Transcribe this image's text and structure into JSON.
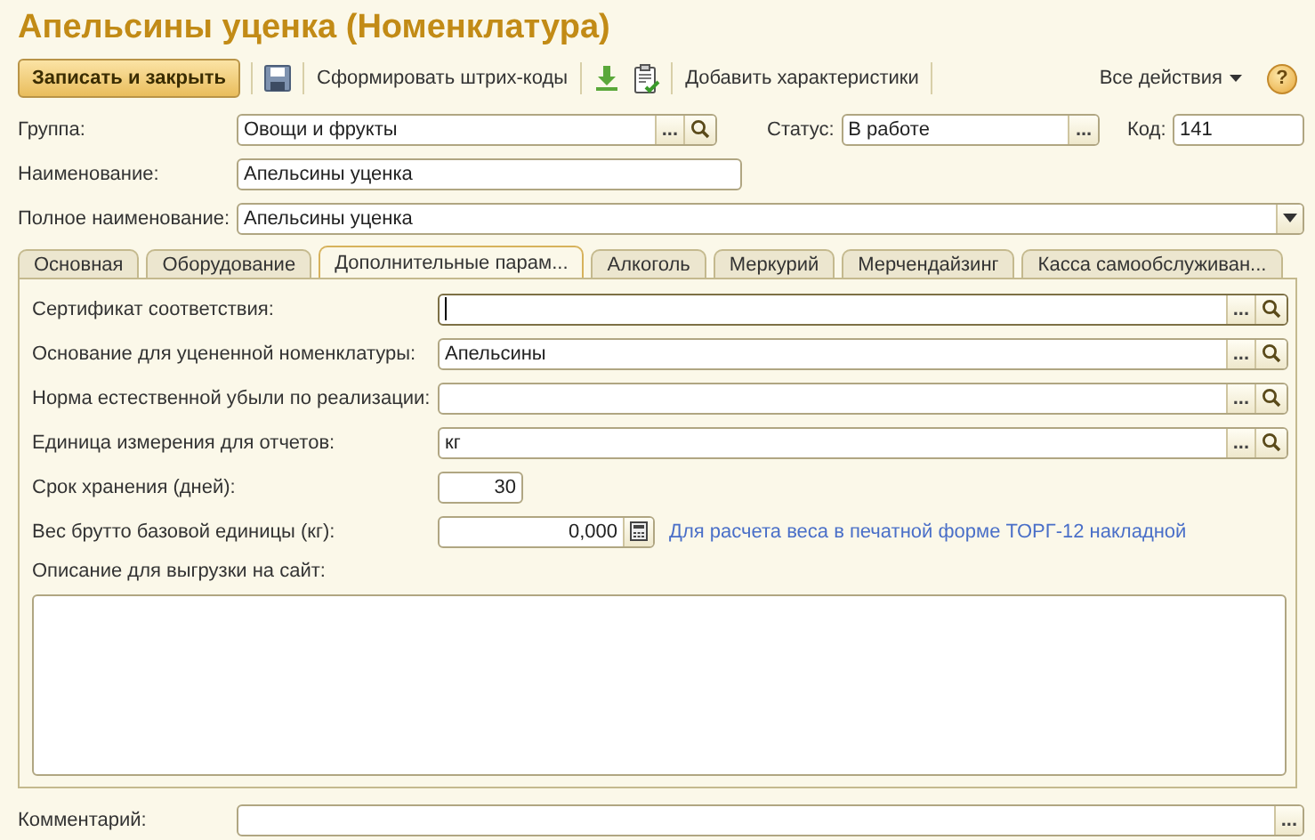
{
  "window": {
    "title": "Апельсины уценка (Номенклатура)"
  },
  "toolbar": [
    {
      "kind": "primary",
      "label": "Записать и закрыть"
    },
    {
      "kind": "save"
    },
    {
      "kind": "text",
      "label": "Сформировать штрих-коды"
    },
    {
      "kind": "download"
    },
    {
      "kind": "report"
    },
    {
      "kind": "text",
      "label": "Добавить характеристики"
    }
  ],
  "all_actions": {
    "label": "Все действия"
  },
  "help_button": {
    "label": "?"
  },
  "header_fields": [
    {
      "label": "Группа:",
      "value": "Овощи и фрукты",
      "kind": "lookup",
      "select_button": "..."
    },
    {
      "label": "Статус:",
      "value": "В работе",
      "kind": "select",
      "select_button": "..."
    },
    {
      "label": "Код:",
      "value": "141",
      "kind": "plain"
    },
    {
      "label": "Наименование:",
      "value": "Апельсины уценка",
      "kind": "plain"
    },
    {
      "label": "Полное наименование:",
      "value": "Апельсины уценка",
      "kind": "dropdown"
    }
  ],
  "tabs": [
    {
      "label": "Основная",
      "selected": false
    },
    {
      "label": "Оборудование",
      "selected": false
    },
    {
      "label": "Дополнительные парам...",
      "selected": true
    },
    {
      "label": "Алкоголь",
      "selected": false
    },
    {
      "label": "Меркурий",
      "selected": false
    },
    {
      "label": "Мерчендайзинг",
      "selected": false
    },
    {
      "label": "Касса самообслуживан...",
      "selected": false
    }
  ],
  "params": [
    {
      "label": "Сертификат соответствия:",
      "kind": "lookup",
      "select_button": "...",
      "focused": true
    },
    {
      "label": "Основание для уцененной номенклатуры:",
      "value": "Апельсины",
      "kind": "lookup",
      "select_button": "...",
      "focused": false
    },
    {
      "label": "Норма естественной убыли по реализации:",
      "kind": "lookup",
      "select_button": "...",
      "focused": false
    },
    {
      "label": "Единица измерения для отчетов:",
      "value": "кг",
      "kind": "lookup",
      "select_button": "...",
      "focused": false
    },
    {
      "label": "Срок хранения (дней):",
      "value": "30",
      "kind": "number",
      "focused": false
    },
    {
      "label": "Вес брутто базовой единицы (кг):",
      "value": "0,000",
      "kind": "calc",
      "focused": false,
      "note": "Для расчета веса в печатной форме ТОРГ-12 накладной"
    }
  ],
  "description": {
    "label": "Описание для выгрузки на сайт:"
  },
  "comment": {
    "label": "Комментарий:",
    "select_button": "..."
  }
}
